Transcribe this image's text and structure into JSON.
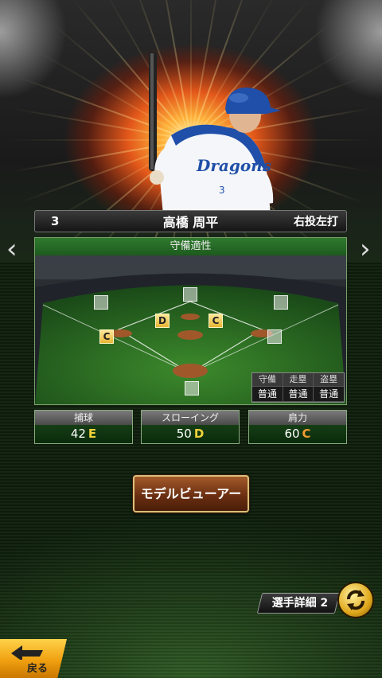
{
  "player": {
    "number": "3",
    "name": "高橋 周平",
    "handedness": "右投左打"
  },
  "nav": {
    "prev": "‹",
    "next": "›"
  },
  "defense": {
    "title": "守備適性",
    "positions": [
      {
        "id": "catcher",
        "grade": ""
      },
      {
        "id": "first-base",
        "grade": ""
      },
      {
        "id": "second-base",
        "grade": "C"
      },
      {
        "id": "third-base",
        "grade": "C"
      },
      {
        "id": "shortstop",
        "grade": "D"
      },
      {
        "id": "left-field",
        "grade": ""
      },
      {
        "id": "center-field",
        "grade": ""
      },
      {
        "id": "right-field",
        "grade": ""
      }
    ],
    "table": {
      "headers": [
        "守備",
        "走塁",
        "盗塁"
      ],
      "values": [
        "普通",
        "普通",
        "普通"
      ]
    }
  },
  "stats": [
    {
      "label": "捕球",
      "value": "42",
      "grade": "E",
      "grade_color": "#f0d23a"
    },
    {
      "label": "スローイング",
      "value": "50",
      "grade": "D",
      "grade_color": "#f0d23a"
    },
    {
      "label": "肩力",
      "value": "60",
      "grade": "C",
      "grade_color": "#f29a2e"
    }
  ],
  "buttons": {
    "model_viewer": "モデルビューアー",
    "player_detail": "選手詳細 2",
    "back": "戻る"
  },
  "colors": {
    "panel_header": "#2f7a2f",
    "button_brown": "#6b2f12",
    "back_yellow": "#f0a010",
    "grade_box": "#e8b432"
  }
}
